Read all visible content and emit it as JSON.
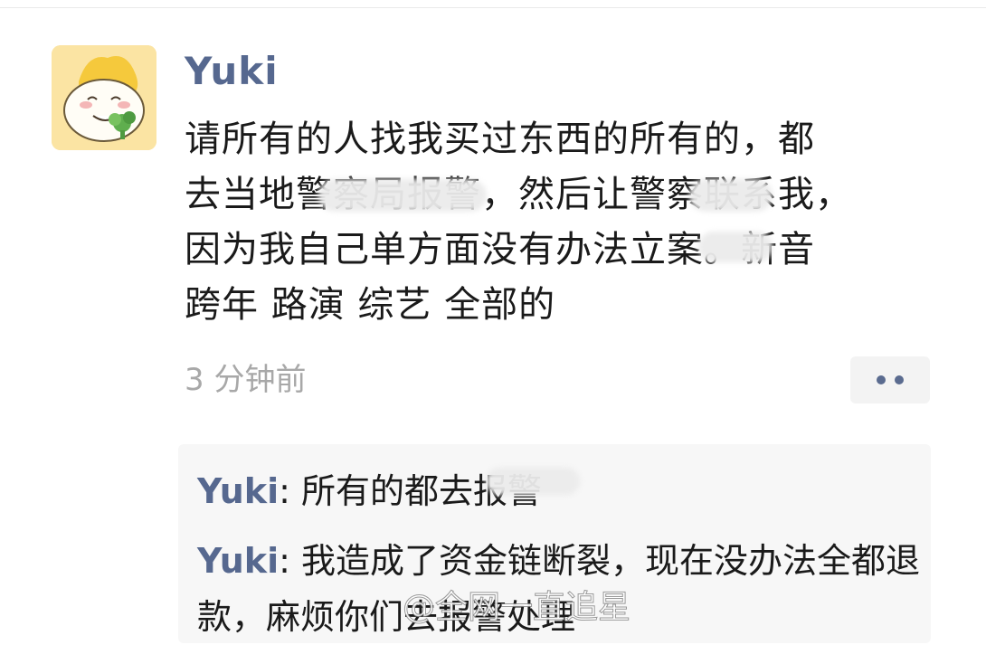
{
  "post": {
    "author": "Yuki",
    "lines": [
      "请所有的人找我买过东西的所有的，都",
      "去当地警察局报警，然后让警察联系我，",
      "因为我自己单方面没有办法立案。新音",
      "跨年 路演 综艺 全部的"
    ],
    "timestamp": "3 分钟前"
  },
  "comments": [
    {
      "author": "Yuki",
      "separator": ": ",
      "text": "所有的都去报警"
    },
    {
      "author": "Yuki",
      "separator": ": ",
      "text": "我造成了资金链断裂，现在没办法全都退款，麻烦你们去报警处理"
    }
  ],
  "watermark": "@全网一直追星",
  "icons": {
    "avatar": "cartoon-avatar-icon",
    "more": "more-dots-icon"
  },
  "colors": {
    "username": "#56688f",
    "timestamp": "#a8a8a8",
    "comment_bg": "#f7f7f7",
    "more_bg": "#f3f3f3"
  }
}
